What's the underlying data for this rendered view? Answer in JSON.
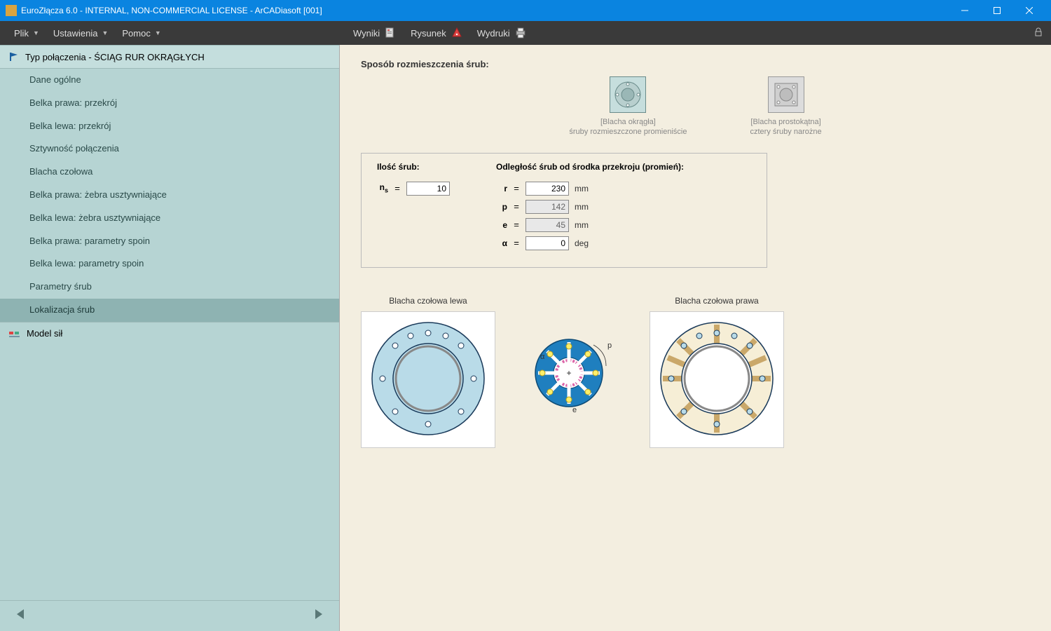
{
  "titlebar": {
    "text": "EuroZłącza 6.0 - INTERNAL, NON-COMMERCIAL LICENSE - ArCADiasoft [001]"
  },
  "menu": {
    "plik": "Plik",
    "ustawienia": "Ustawienia",
    "pomoc": "Pomoc",
    "wyniki": "Wyniki",
    "rysunek": "Rysunek",
    "wydruki": "Wydruki"
  },
  "sidebar": {
    "header": "Typ połączenia - ŚCIĄG RUR OKRĄGŁYCH",
    "items": [
      "Dane ogólne",
      "Belka prawa: przekrój",
      "Belka lewa: przekrój",
      "Sztywność połączenia",
      "Blacha czołowa",
      "Belka prawa: żebra usztywniające",
      "Belka lewa: żebra usztywniające",
      "Belka prawa: parametry spoin",
      "Belka lewa: parametry spoin",
      "Parametry śrub",
      "Lokalizacja śrub"
    ],
    "active_index": 10,
    "model": "Model sił"
  },
  "main": {
    "section_title": "Sposób rozmieszczenia śrub:",
    "optA_line1": "[Blacha okrągła]",
    "optA_line2": "śruby rozmieszczone promieniście",
    "optB_line1": "[Blacha prostokątna]",
    "optB_line2": "cztery śruby narożne",
    "head_left": "Ilość śrub:",
    "head_right": "Odległość śrub od środka przekroju (promień):",
    "ns_label": "n",
    "ns_sub": "s",
    "ns_value": "10",
    "r_label": "r",
    "r_value": "230",
    "r_unit": "mm",
    "p_label": "p",
    "p_value": "142",
    "p_unit": "mm",
    "e_label": "e",
    "e_value": "45",
    "e_unit": "mm",
    "a_label": "α",
    "a_value": "0",
    "a_unit": "deg",
    "diag_left": "Blacha czołowa lewa",
    "diag_right": "Blacha czołowa prawa"
  }
}
